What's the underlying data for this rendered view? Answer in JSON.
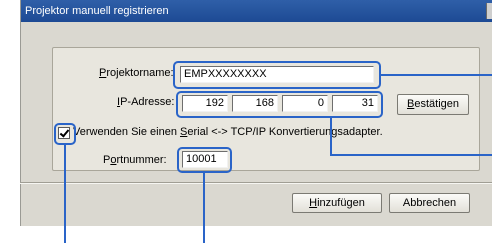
{
  "dialog": {
    "title": "Projektor manuell registrieren"
  },
  "form": {
    "projector_name": {
      "label_prefix": "P",
      "label_rest": "rojektorname:",
      "value": "EMPXXXXXXXX"
    },
    "ip_address": {
      "label_prefix": "I",
      "label_rest": "P-Adresse:",
      "octets": [
        "192",
        "168",
        "0",
        "31"
      ],
      "confirm_button": {
        "label_prefix": "B",
        "label_rest": "estätigen"
      }
    },
    "serial_adapter": {
      "checked": true,
      "label_part1": "Verwenden Sie einen ",
      "label_underlined": "S",
      "label_part2": "erial <-> TCP/IP Konvertierungsadapter."
    },
    "port": {
      "label_prefix": "P",
      "label_u": "o",
      "label_rest": "rtnummer:",
      "value": "10001"
    }
  },
  "buttons": {
    "add": {
      "label_prefix": "H",
      "label_rest": "inzufügen"
    },
    "cancel": {
      "label": "Abbrechen"
    }
  },
  "colors": {
    "callout": "#2a64c8",
    "title_bar": "#1d4a94",
    "dialog_bg": "#dad8d0"
  }
}
